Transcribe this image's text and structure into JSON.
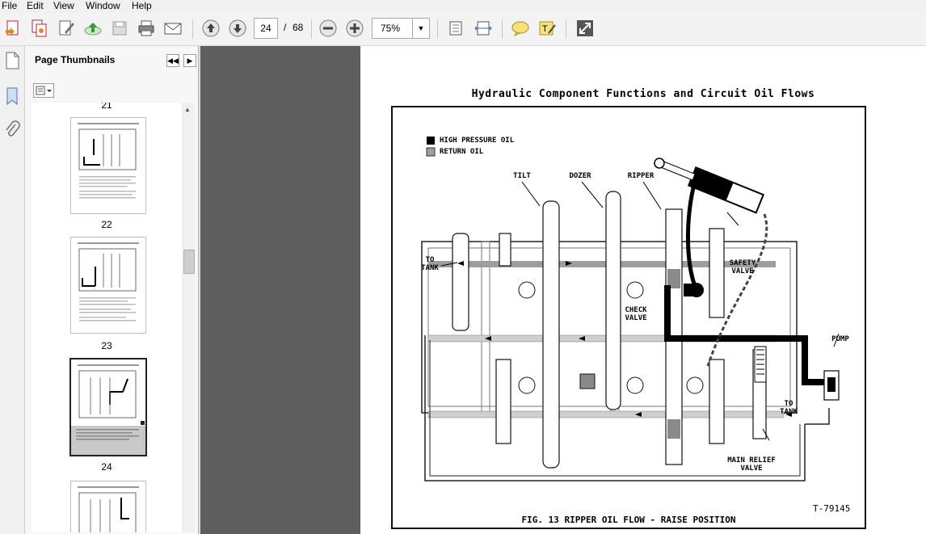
{
  "menu": [
    "File",
    "Edit",
    "View",
    "Window",
    "Help"
  ],
  "toolbar": {
    "current_page": "24",
    "page_sep": "/",
    "total_pages": "68",
    "zoom": "75%",
    "icons": [
      "create-pdf",
      "combine",
      "edit",
      "upload",
      "save",
      "print",
      "email",
      "prev-page",
      "next-page",
      "zoom-out",
      "zoom-in",
      "fit-page",
      "fit-width",
      "comment",
      "highlight",
      "expand"
    ]
  },
  "panel": {
    "title": "Page Thumbnails",
    "top_partial_label": "21",
    "thumbnails": [
      {
        "label": "22"
      },
      {
        "label": "23"
      },
      {
        "label": "24"
      }
    ]
  },
  "document": {
    "title": "Hydraulic Component Functions  and Circuit Oil Flows",
    "legend_high": "HIGH PRESSURE OIL",
    "legend_return": "RETURN OIL",
    "labels": {
      "tilt": "TILT",
      "dozer": "DOZER",
      "ripper": "RIPPER",
      "to_tank_left": "TO\nTANK",
      "safety_valve": "SAFETY\nVALVE",
      "check_valve": "CHECK\nVALVE",
      "pump": "PUMP",
      "to_tank_right": "TO\nTANK",
      "main_relief": "MAIN RELIEF\nVALVE"
    },
    "caption": "FIG. 13  RIPPER OIL FLOW - RAISE POSITION",
    "code": "T-79145"
  }
}
